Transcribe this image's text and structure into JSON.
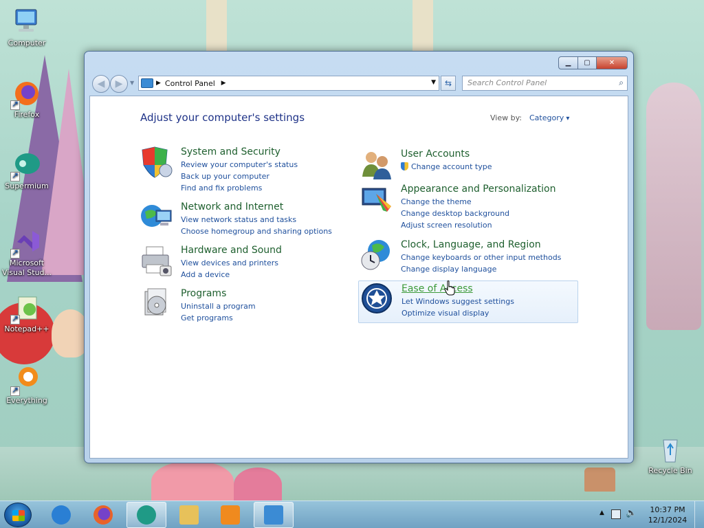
{
  "desktop": {
    "icons": [
      {
        "label": "Computer",
        "icon": "computer-icon"
      },
      {
        "label": "Firefox",
        "icon": "firefox-icon"
      },
      {
        "label": "Supermium",
        "icon": "supermium-icon"
      },
      {
        "label": "Microsoft Visual Stud...",
        "icon": "visual-studio-icon"
      },
      {
        "label": "Notepad++",
        "icon": "notepadpp-icon"
      },
      {
        "label": "Everything",
        "icon": "everything-icon"
      },
      {
        "label": "Recycle Bin",
        "icon": "recycle-bin-icon"
      }
    ]
  },
  "window": {
    "controls": {
      "minimize": "▁",
      "maximize": "▢",
      "close": "✕"
    },
    "address": {
      "location": "Control Panel"
    },
    "search": {
      "placeholder": "Search Control Panel"
    },
    "title": "Adjust your computer's settings",
    "view_by": {
      "label": "View by:",
      "value": "Category"
    },
    "categories_left": [
      {
        "title": "System and Security",
        "icon": "shield-icon",
        "links": [
          "Review your computer's status",
          "Back up your computer",
          "Find and fix problems"
        ]
      },
      {
        "title": "Network and Internet",
        "icon": "network-globe-icon",
        "links": [
          "View network status and tasks",
          "Choose homegroup and sharing options"
        ]
      },
      {
        "title": "Hardware and Sound",
        "icon": "printer-icon",
        "links": [
          "View devices and printers",
          "Add a device"
        ]
      },
      {
        "title": "Programs",
        "icon": "programs-icon",
        "links": [
          "Uninstall a program",
          "Get programs"
        ]
      }
    ],
    "categories_right": [
      {
        "title": "User Accounts",
        "icon": "users-icon",
        "links": [
          "Change account type"
        ]
      },
      {
        "title": "Appearance and Personalization",
        "icon": "monitor-paint-icon",
        "links": [
          "Change the theme",
          "Change desktop background",
          "Adjust screen resolution"
        ]
      },
      {
        "title": "Clock, Language, and Region",
        "icon": "globe-clock-icon",
        "links": [
          "Change keyboards or other input methods",
          "Change display language"
        ]
      },
      {
        "title": "Ease of Access",
        "icon": "ease-of-access-icon",
        "links": [
          "Let Windows suggest settings",
          "Optimize visual display"
        ]
      }
    ]
  },
  "taskbar": {
    "items": [
      {
        "name": "internet-explorer",
        "active": false,
        "color": "#2a7fd4"
      },
      {
        "name": "firefox",
        "active": false,
        "color": "#e8622a"
      },
      {
        "name": "supermium",
        "active": true,
        "color": "#1f9a86"
      },
      {
        "name": "file-explorer",
        "active": false,
        "color": "#e7c15a"
      },
      {
        "name": "media-player",
        "active": false,
        "color": "#f08a1e"
      },
      {
        "name": "control-panel",
        "active": true,
        "color": "#3b8bd4"
      }
    ],
    "clock": {
      "time": "10:37 PM",
      "date": "12/1/2024"
    }
  }
}
